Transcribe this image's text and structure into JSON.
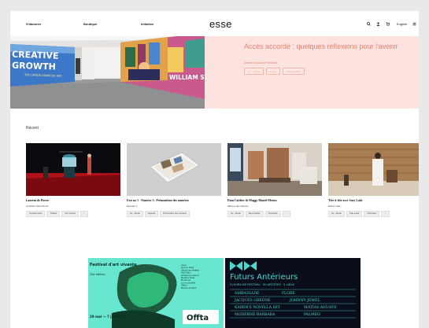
{
  "nav": {
    "links": [
      "S'abonner",
      "Boutique",
      "Initiative"
    ],
    "logo": "esse",
    "language": "English",
    "icons": [
      "search-icon",
      "user-icon",
      "cart-icon",
      "menu-icon"
    ]
  },
  "hero": {
    "title": "Accès accordé : quelques réflexions pour l'avenir",
    "author": "Jessie McLaren Bédard",
    "tags": [
      "Art · Social",
      "Accès",
      "Design social"
    ],
    "image": {
      "mural_text_1": "CREATIVE",
      "mural_text_2": "GROWTH",
      "mural_text_3": "THE UPSIDE DOWN OF ART",
      "mural_text_4": "WILLIAM SCOTT"
    }
  },
  "recent": {
    "heading": "Récent",
    "cards": [
      {
        "title": "Laurent de Pierre",
        "author": "Christian Saint-Pierre",
        "tags": [
          "Compte rendu",
          "Théâtre",
          "Arts vivants",
          "..."
        ]
      },
      {
        "title": "Esse no 1 - Numéro 1 : Prémonition des numéros",
        "author": "Épisode 1",
        "tags": [
          "Art · Social",
          "Capsule",
          "Prémonition des numéros"
        ]
      },
      {
        "title": "Dans l'atelier de Maggy Hamel-Metsos",
        "author": "Marie-Lupin Dames",
        "tags": [
          "Art · Social",
          "Dans l'atelier",
          "Chronique",
          "..."
        ]
      },
      {
        "title": "Tête-à-tête avec Suzy Lake",
        "author": "Esther Hale",
        "tags": [
          "Art · Social",
          "Tête-à-tête",
          "Chronique",
          "..."
        ]
      }
    ]
  },
  "ads": [
    {
      "title": "Festival d'art vivante",
      "subtitle": "20e édition",
      "names": [
        "Anne",
        "Jeremy Fiske",
        "Alexandra Maltais",
        "Paul Marc",
        "Guillaume Lebrun",
        "Martine Viale",
        "Marianne",
        "Lucie Lavallée",
        "Alexis",
        "Pierre Lambert"
      ],
      "dates": "29 mai — 7 juin 2025",
      "logo": "Offta"
    },
    {
      "title": "Futurs Antérieurs",
      "subtitle": "5 JOURS DE FESTIVAL · 50 ARTISTES · 5 LIEUX",
      "lines": [
        "AMBASSADE",
        "FLORE",
        "JACQUES GREENE",
        "JOHNNY JEWEL",
        "KAREN'S NOVELLA SET",
        "MATIAS AGUAYO",
        "MODERNE BARBARA",
        "PALMEO"
      ]
    }
  ],
  "colors": {
    "hero_bg": "#fde3df",
    "hero_accent": "#e88070",
    "offta_bg": "#68e6cf",
    "futurs_bg": "#0a0e1a",
    "futurs_accent": "#4fd6cf"
  }
}
